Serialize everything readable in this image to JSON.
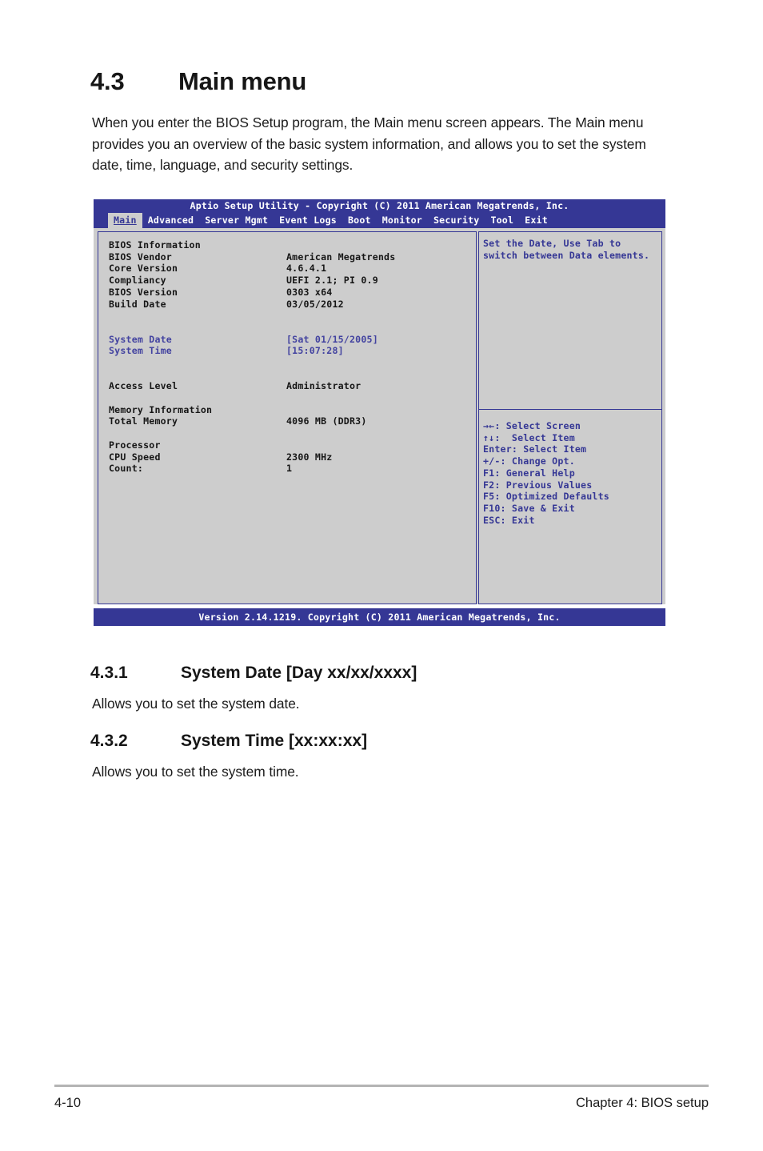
{
  "document": {
    "section": {
      "number": "4.3",
      "title": "Main menu",
      "paragraph": "When you enter the BIOS Setup program, the Main menu screen appears. The Main menu provides you an overview of the basic system information, and allows you to set the system date, time, language, and security settings."
    },
    "subsections": [
      {
        "number": "4.3.1",
        "title": "System Date [Day xx/xx/xxxx]",
        "paragraph": "Allows you to set the system date."
      },
      {
        "number": "4.3.2",
        "title": "System Time [xx:xx:xx]",
        "paragraph": "Allows you to set the system time."
      }
    ],
    "footer": {
      "page_number": "4-10",
      "chapter": "Chapter 4: BIOS setup"
    }
  },
  "bios": {
    "title_bar": "Aptio Setup Utility - Copyright (C) 2011 American Megatrends, Inc.",
    "tabs": [
      {
        "label": "Main",
        "active": true
      },
      {
        "label": "Advanced",
        "active": false
      },
      {
        "label": "Server Mgmt",
        "active": false
      },
      {
        "label": "Event Logs",
        "active": false
      },
      {
        "label": "Boot",
        "active": false
      },
      {
        "label": "Monitor",
        "active": false
      },
      {
        "label": "Security",
        "active": false
      },
      {
        "label": "Tool",
        "active": false
      },
      {
        "label": "Exit",
        "active": false
      }
    ],
    "rows": [
      {
        "label": "BIOS Information",
        "value": "",
        "style": "plain"
      },
      {
        "label": "BIOS Vendor",
        "value": "American Megatrends",
        "style": "plain"
      },
      {
        "label": "Core Version",
        "value": "4.6.4.1",
        "style": "plain"
      },
      {
        "label": "Compliancy",
        "value": "UEFI 2.1; PI 0.9",
        "style": "plain"
      },
      {
        "label": "BIOS Version",
        "value": "0303 x64",
        "style": "plain"
      },
      {
        "label": "Build Date",
        "value": "03/05/2012",
        "style": "plain"
      },
      {
        "label": "",
        "value": "",
        "style": "spacer"
      },
      {
        "label": "",
        "value": "",
        "style": "spacer"
      },
      {
        "label": "System Date",
        "value": "[Sat 01/15/2005]",
        "style": "blue"
      },
      {
        "label": "System Time",
        "value": "[15:07:28]",
        "style": "blue"
      },
      {
        "label": "",
        "value": "",
        "style": "spacer"
      },
      {
        "label": "",
        "value": "",
        "style": "spacer"
      },
      {
        "label": "Access Level",
        "value": "Administrator",
        "style": "plain"
      },
      {
        "label": "",
        "value": "",
        "style": "spacer"
      },
      {
        "label": "Memory Information",
        "value": "",
        "style": "plain"
      },
      {
        "label": "Total Memory",
        "value": "4096 MB (DDR3)",
        "style": "plain"
      },
      {
        "label": "",
        "value": "",
        "style": "spacer"
      },
      {
        "label": "Processor",
        "value": "",
        "style": "plain"
      },
      {
        "label": "CPU Speed",
        "value": "2300 MHz",
        "style": "plain"
      },
      {
        "label": "Count:",
        "value": "1",
        "style": "plain"
      }
    ],
    "help": [
      "Set the Date, Use Tab to",
      "switch between Data elements."
    ],
    "keys": [
      "→←: Select Screen",
      "↑↓:  Select Item",
      "Enter: Select Item",
      "+/-: Change Opt.",
      "F1: General Help",
      "F2: Previous Values",
      "F5: Optimized Defaults",
      "F10: Save & Exit",
      "ESC: Exit"
    ],
    "version_bar": "Version 2.14.1219. Copyright (C) 2011 American Megatrends, Inc."
  },
  "colors": {
    "bios_blue": "#353795",
    "bios_gray": "#cdcdcd",
    "bios_text": "#161616",
    "bios_highlight_text": "#4343a0"
  }
}
